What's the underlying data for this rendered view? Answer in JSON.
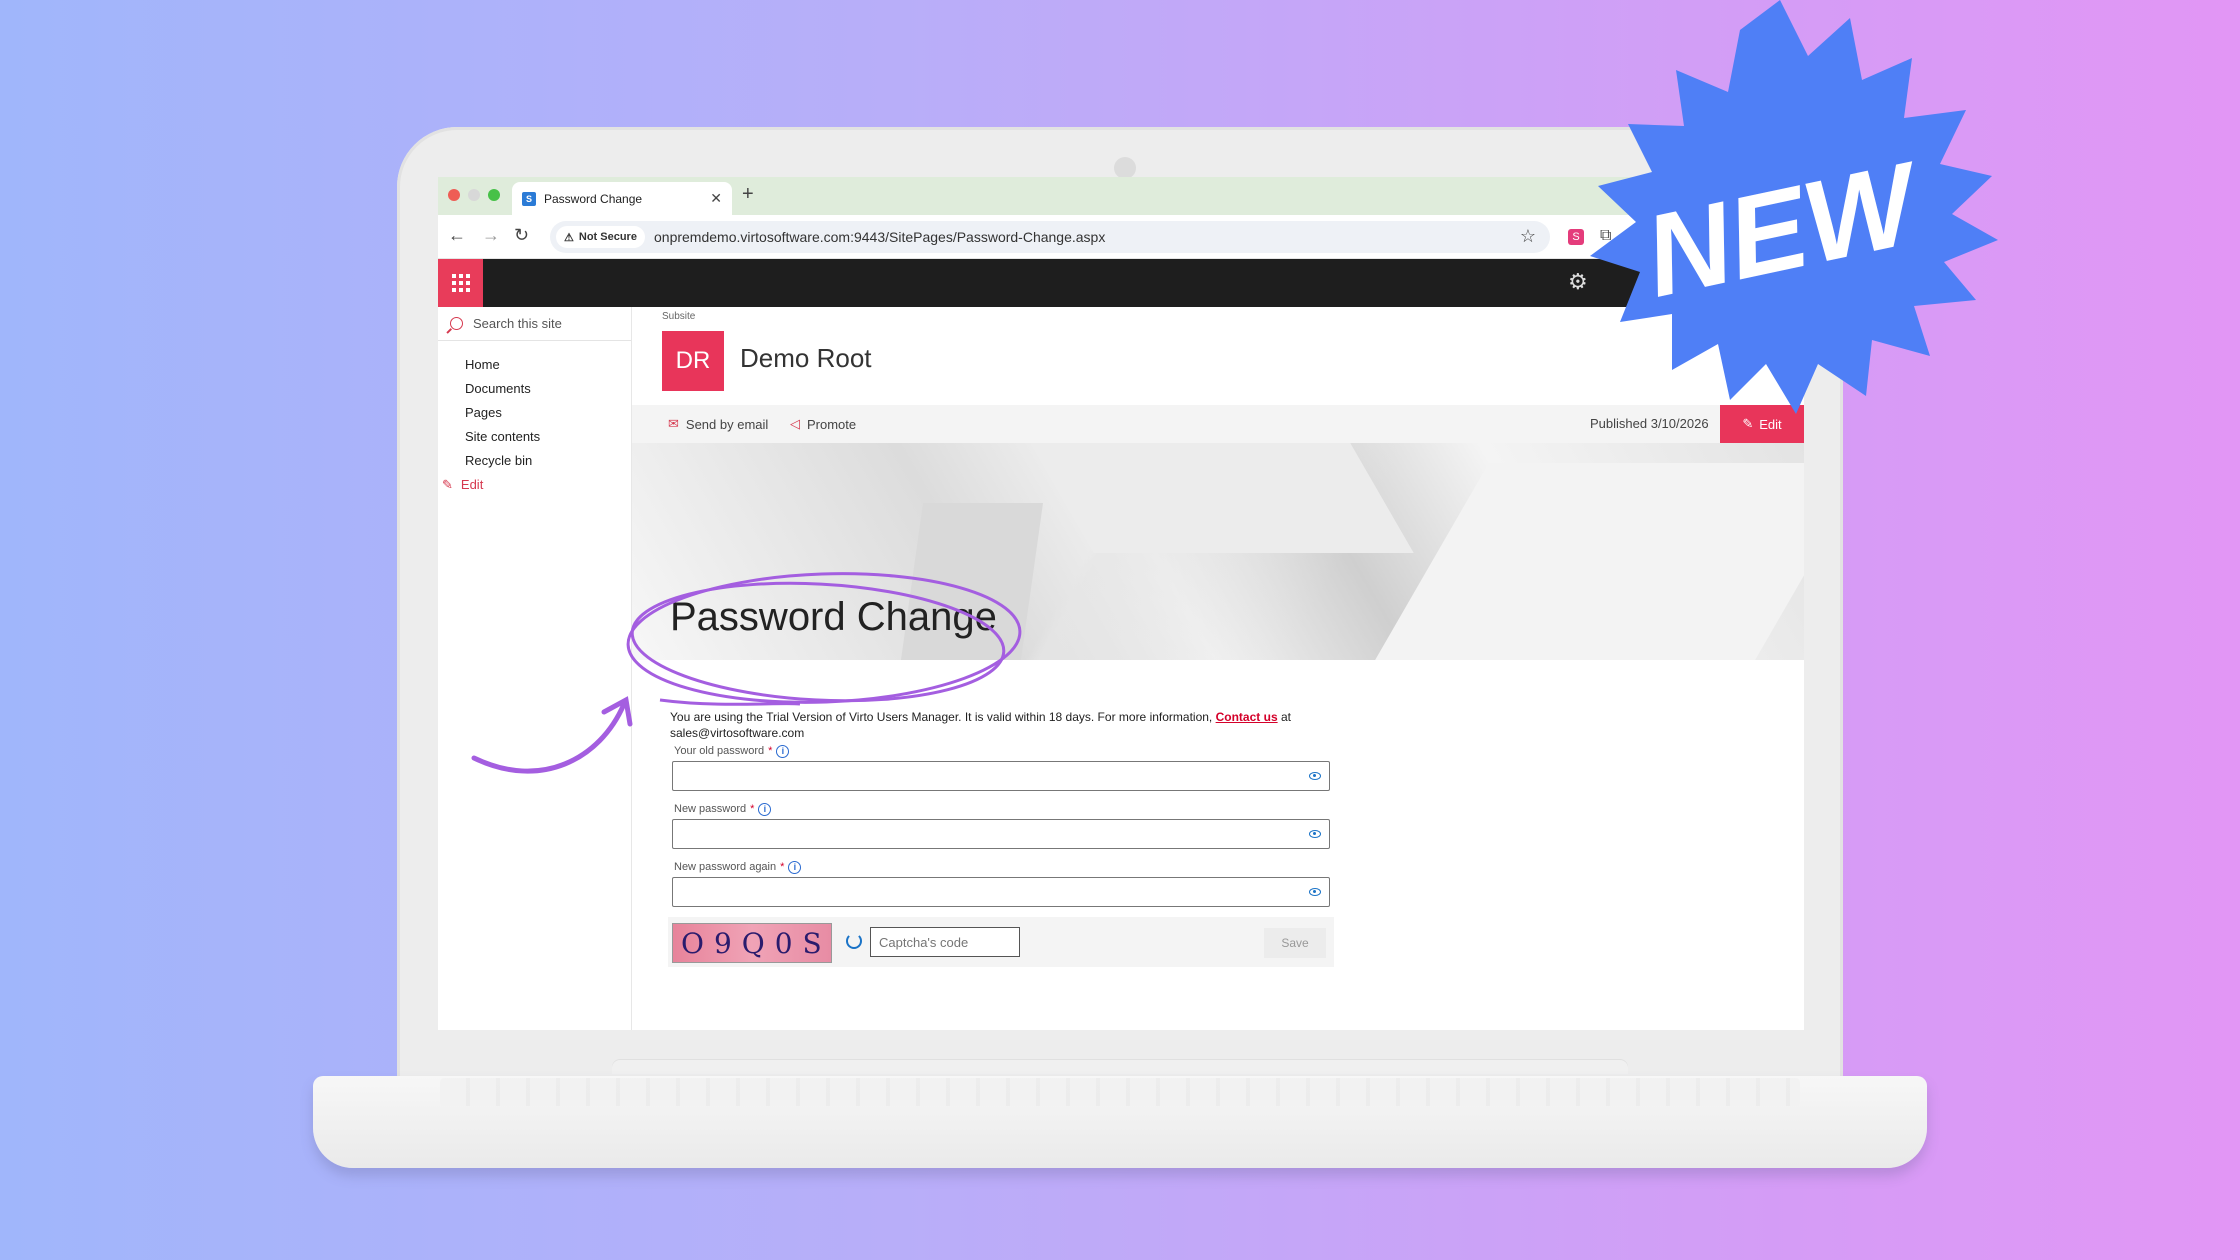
{
  "browser": {
    "tab_title": "Password Change",
    "new_tab": "+",
    "security": "Not Secure",
    "url": "onpremdemo.virtosoftware.com:9443/SitePages/Password-Change.aspx"
  },
  "site": {
    "subsite_label": "Subsite",
    "logo_initials": "DR",
    "title": "Demo Root"
  },
  "nav": {
    "search_placeholder": "Search this site",
    "items": [
      "Home",
      "Documents",
      "Pages",
      "Site contents",
      "Recycle bin"
    ],
    "edit_label": "Edit"
  },
  "commandbar": {
    "send_by_email": "Send by email",
    "promote": "Promote",
    "published": "Published 3/10/2026",
    "edit": "Edit"
  },
  "page": {
    "title": "Password Change",
    "trial_text_1": "You are using the Trial Version of Virto Users Manager. It is valid within 18 days. For more information,",
    "contact_link": "Contact us",
    "trial_text_2": "at sales@virtosoftware.com"
  },
  "form": {
    "old_password_label": "Your old password",
    "new_password_label": "New password",
    "new_password_again_label": "New password again",
    "required_marker": "*",
    "captcha_text": "O9Q0S",
    "captcha_placeholder": "Captcha's code",
    "save_label": "Save"
  },
  "badge": {
    "text": "NEW",
    "color": "#4f7ff6"
  },
  "colors": {
    "accent": "#e8355a",
    "annotation": "#a45ee0"
  }
}
